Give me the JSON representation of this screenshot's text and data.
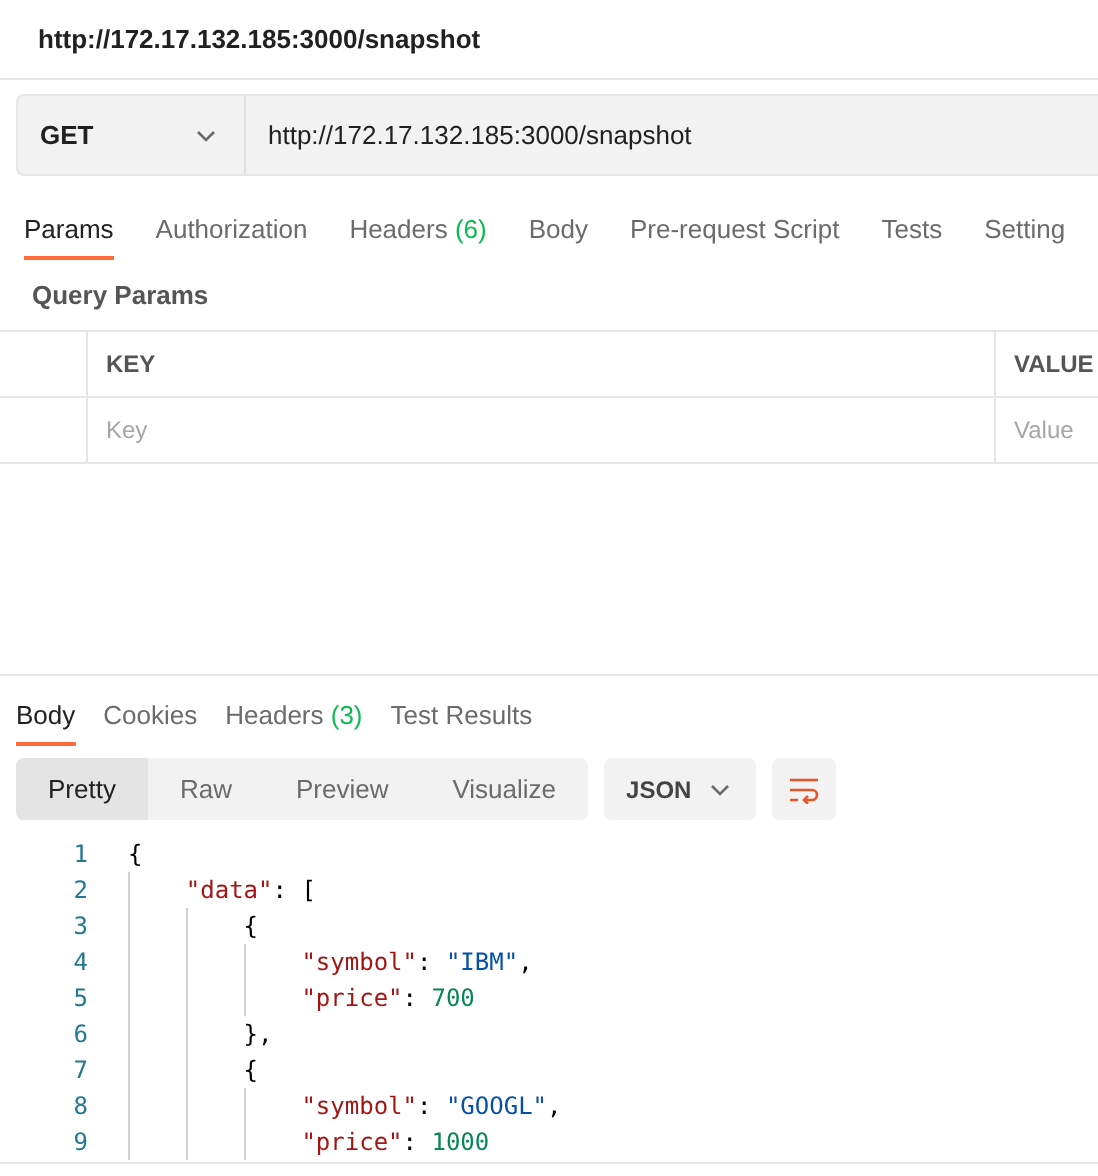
{
  "title": "http://172.17.132.185:3000/snapshot",
  "request": {
    "method": "GET",
    "url": "http://172.17.132.185:3000/snapshot"
  },
  "request_tabs": [
    {
      "label": "Params",
      "selected": true
    },
    {
      "label": "Authorization",
      "selected": false
    },
    {
      "label": "Headers",
      "count": "(6)",
      "selected": false
    },
    {
      "label": "Body",
      "selected": false
    },
    {
      "label": "Pre-request Script",
      "selected": false
    },
    {
      "label": "Tests",
      "selected": false
    },
    {
      "label": "Setting",
      "selected": false
    }
  ],
  "query_params": {
    "title": "Query Params",
    "columns": [
      "KEY",
      "VALUE"
    ],
    "new_row": {
      "key_placeholder": "Key",
      "value_placeholder": "Value"
    }
  },
  "response_tabs": [
    {
      "label": "Body",
      "selected": true
    },
    {
      "label": "Cookies",
      "selected": false
    },
    {
      "label": "Headers",
      "count": "(3)",
      "selected": false
    },
    {
      "label": "Test Results",
      "selected": false
    }
  ],
  "view_modes": [
    {
      "label": "Pretty",
      "selected": true
    },
    {
      "label": "Raw",
      "selected": false
    },
    {
      "label": "Preview",
      "selected": false
    },
    {
      "label": "Visualize",
      "selected": false
    }
  ],
  "format": "JSON",
  "code": [
    {
      "number": "1",
      "tokens": [
        {
          "kind": "punct",
          "text": "{"
        }
      ]
    },
    {
      "number": "2",
      "tokens": [
        {
          "kind": "key",
          "text": "    \"data\""
        },
        {
          "kind": "punct",
          "text": ": ["
        }
      ]
    },
    {
      "number": "3",
      "tokens": [
        {
          "kind": "punct",
          "text": "        {"
        }
      ]
    },
    {
      "number": "4",
      "tokens": [
        {
          "kind": "key",
          "text": "            \"symbol\""
        },
        {
          "kind": "punct",
          "text": ": "
        },
        {
          "kind": "string",
          "text": "\"IBM\""
        },
        {
          "kind": "punct",
          "text": ","
        }
      ]
    },
    {
      "number": "5",
      "tokens": [
        {
          "kind": "key",
          "text": "            \"price\""
        },
        {
          "kind": "punct",
          "text": ": "
        },
        {
          "kind": "number",
          "text": "700"
        }
      ]
    },
    {
      "number": "6",
      "tokens": [
        {
          "kind": "punct",
          "text": "        },"
        }
      ]
    },
    {
      "number": "7",
      "tokens": [
        {
          "kind": "punct",
          "text": "        {"
        }
      ]
    },
    {
      "number": "8",
      "tokens": [
        {
          "kind": "key",
          "text": "            \"symbol\""
        },
        {
          "kind": "punct",
          "text": ": "
        },
        {
          "kind": "string",
          "text": "\"GOOGL\""
        },
        {
          "kind": "punct",
          "text": ","
        }
      ]
    },
    {
      "number": "9",
      "tokens": [
        {
          "kind": "key",
          "text": "            \"price\""
        },
        {
          "kind": "punct",
          "text": ": "
        },
        {
          "kind": "number",
          "text": "1000"
        }
      ]
    }
  ]
}
